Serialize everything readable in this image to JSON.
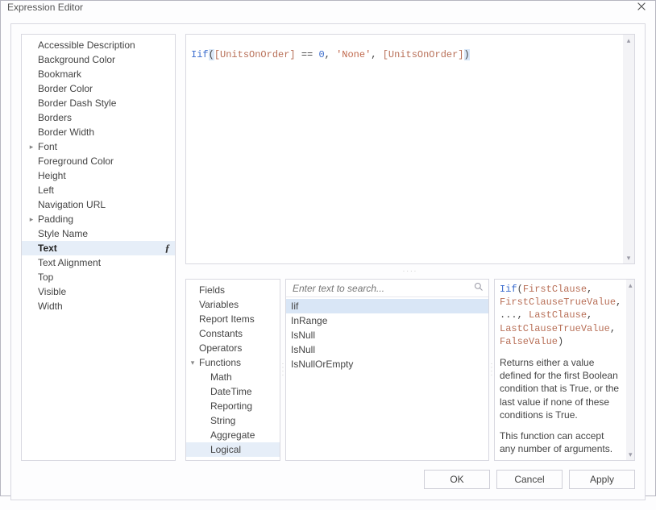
{
  "window": {
    "title": "Expression Editor"
  },
  "left_tree": {
    "selected_index": 14,
    "items": [
      {
        "label": "Accessible Description",
        "expandable": false
      },
      {
        "label": "Background Color",
        "expandable": false
      },
      {
        "label": "Bookmark",
        "expandable": false
      },
      {
        "label": "Border Color",
        "expandable": false
      },
      {
        "label": "Border Dash Style",
        "expandable": false
      },
      {
        "label": "Borders",
        "expandable": false
      },
      {
        "label": "Border Width",
        "expandable": false
      },
      {
        "label": "Font",
        "expandable": true
      },
      {
        "label": "Foreground Color",
        "expandable": false
      },
      {
        "label": "Height",
        "expandable": false
      },
      {
        "label": "Left",
        "expandable": false
      },
      {
        "label": "Navigation URL",
        "expandable": false
      },
      {
        "label": "Padding",
        "expandable": true
      },
      {
        "label": "Style Name",
        "expandable": false
      },
      {
        "label": "Text",
        "expandable": false,
        "has_fx": true
      },
      {
        "label": "Text Alignment",
        "expandable": false
      },
      {
        "label": "Top",
        "expandable": false
      },
      {
        "label": "Visible",
        "expandable": false
      },
      {
        "label": "Width",
        "expandable": false
      }
    ]
  },
  "editor": {
    "tokens": {
      "t0": "Iif",
      "t1": "(",
      "t2": "[UnitsOnOrder]",
      "t3": " == ",
      "t4": "0",
      "t5": ", ",
      "t6": "'None'",
      "t7": ", ",
      "t8": "[UnitsOnOrder]",
      "t9": ")"
    }
  },
  "categories": {
    "selected": "Logical",
    "expanded": "Functions",
    "items": [
      {
        "label": "Fields",
        "level": 0
      },
      {
        "label": "Variables",
        "level": 0
      },
      {
        "label": "Report Items",
        "level": 0
      },
      {
        "label": "Constants",
        "level": 0
      },
      {
        "label": "Operators",
        "level": 0
      },
      {
        "label": "Functions",
        "level": 0,
        "expandable": true,
        "expanded": true
      },
      {
        "label": "Math",
        "level": 1
      },
      {
        "label": "DateTime",
        "level": 1
      },
      {
        "label": "Reporting",
        "level": 1
      },
      {
        "label": "String",
        "level": 1
      },
      {
        "label": "Aggregate",
        "level": 1
      },
      {
        "label": "Logical",
        "level": 1
      }
    ]
  },
  "search": {
    "placeholder": "Enter text to search..."
  },
  "functions": {
    "selected_index": 0,
    "items": [
      {
        "label": "Iif"
      },
      {
        "label": "InRange"
      },
      {
        "label": "IsNull"
      },
      {
        "label": "IsNull"
      },
      {
        "label": "IsNullOrEmpty"
      }
    ]
  },
  "description": {
    "sig": {
      "fn": "Iif",
      "lp": "(",
      "a0": "FirstClause",
      "c0": ", ",
      "a1": "FirstClauseTrueValue",
      "c1": ", ..., ",
      "a2": "LastClause",
      "c2": ", ",
      "a3": "LastClauseTrueValue",
      "c3": ", ",
      "a4": "FalseValue",
      "rp": ")"
    },
    "para1": "Returns either a value defined for the first Boolean condition that is True, or the last value if none of these conditions is True.",
    "para2": "This function can accept any number of arguments."
  },
  "buttons": {
    "ok": "OK",
    "cancel": "Cancel",
    "apply": "Apply"
  },
  "glyphs": {
    "arrow_right": "▸",
    "arrow_down": "▾",
    "scroll_up": "▴",
    "scroll_down": "▾",
    "dots": "····",
    "fx": "ƒ"
  }
}
